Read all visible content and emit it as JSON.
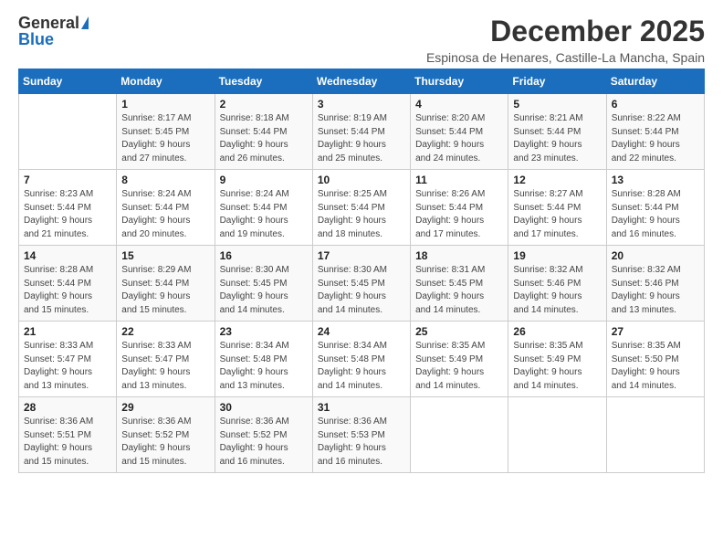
{
  "logo": {
    "general": "General",
    "blue": "Blue"
  },
  "title": "December 2025",
  "subtitle": "Espinosa de Henares, Castille-La Mancha, Spain",
  "headers": [
    "Sunday",
    "Monday",
    "Tuesday",
    "Wednesday",
    "Thursday",
    "Friday",
    "Saturday"
  ],
  "weeks": [
    [
      {
        "day": "",
        "info": ""
      },
      {
        "day": "1",
        "info": "Sunrise: 8:17 AM\nSunset: 5:45 PM\nDaylight: 9 hours\nand 27 minutes."
      },
      {
        "day": "2",
        "info": "Sunrise: 8:18 AM\nSunset: 5:44 PM\nDaylight: 9 hours\nand 26 minutes."
      },
      {
        "day": "3",
        "info": "Sunrise: 8:19 AM\nSunset: 5:44 PM\nDaylight: 9 hours\nand 25 minutes."
      },
      {
        "day": "4",
        "info": "Sunrise: 8:20 AM\nSunset: 5:44 PM\nDaylight: 9 hours\nand 24 minutes."
      },
      {
        "day": "5",
        "info": "Sunrise: 8:21 AM\nSunset: 5:44 PM\nDaylight: 9 hours\nand 23 minutes."
      },
      {
        "day": "6",
        "info": "Sunrise: 8:22 AM\nSunset: 5:44 PM\nDaylight: 9 hours\nand 22 minutes."
      }
    ],
    [
      {
        "day": "7",
        "info": "Sunrise: 8:23 AM\nSunset: 5:44 PM\nDaylight: 9 hours\nand 21 minutes."
      },
      {
        "day": "8",
        "info": "Sunrise: 8:24 AM\nSunset: 5:44 PM\nDaylight: 9 hours\nand 20 minutes."
      },
      {
        "day": "9",
        "info": "Sunrise: 8:24 AM\nSunset: 5:44 PM\nDaylight: 9 hours\nand 19 minutes."
      },
      {
        "day": "10",
        "info": "Sunrise: 8:25 AM\nSunset: 5:44 PM\nDaylight: 9 hours\nand 18 minutes."
      },
      {
        "day": "11",
        "info": "Sunrise: 8:26 AM\nSunset: 5:44 PM\nDaylight: 9 hours\nand 17 minutes."
      },
      {
        "day": "12",
        "info": "Sunrise: 8:27 AM\nSunset: 5:44 PM\nDaylight: 9 hours\nand 17 minutes."
      },
      {
        "day": "13",
        "info": "Sunrise: 8:28 AM\nSunset: 5:44 PM\nDaylight: 9 hours\nand 16 minutes."
      }
    ],
    [
      {
        "day": "14",
        "info": "Sunrise: 8:28 AM\nSunset: 5:44 PM\nDaylight: 9 hours\nand 15 minutes."
      },
      {
        "day": "15",
        "info": "Sunrise: 8:29 AM\nSunset: 5:44 PM\nDaylight: 9 hours\nand 15 minutes."
      },
      {
        "day": "16",
        "info": "Sunrise: 8:30 AM\nSunset: 5:45 PM\nDaylight: 9 hours\nand 14 minutes."
      },
      {
        "day": "17",
        "info": "Sunrise: 8:30 AM\nSunset: 5:45 PM\nDaylight: 9 hours\nand 14 minutes."
      },
      {
        "day": "18",
        "info": "Sunrise: 8:31 AM\nSunset: 5:45 PM\nDaylight: 9 hours\nand 14 minutes."
      },
      {
        "day": "19",
        "info": "Sunrise: 8:32 AM\nSunset: 5:46 PM\nDaylight: 9 hours\nand 14 minutes."
      },
      {
        "day": "20",
        "info": "Sunrise: 8:32 AM\nSunset: 5:46 PM\nDaylight: 9 hours\nand 13 minutes."
      }
    ],
    [
      {
        "day": "21",
        "info": "Sunrise: 8:33 AM\nSunset: 5:47 PM\nDaylight: 9 hours\nand 13 minutes."
      },
      {
        "day": "22",
        "info": "Sunrise: 8:33 AM\nSunset: 5:47 PM\nDaylight: 9 hours\nand 13 minutes."
      },
      {
        "day": "23",
        "info": "Sunrise: 8:34 AM\nSunset: 5:48 PM\nDaylight: 9 hours\nand 13 minutes."
      },
      {
        "day": "24",
        "info": "Sunrise: 8:34 AM\nSunset: 5:48 PM\nDaylight: 9 hours\nand 14 minutes."
      },
      {
        "day": "25",
        "info": "Sunrise: 8:35 AM\nSunset: 5:49 PM\nDaylight: 9 hours\nand 14 minutes."
      },
      {
        "day": "26",
        "info": "Sunrise: 8:35 AM\nSunset: 5:49 PM\nDaylight: 9 hours\nand 14 minutes."
      },
      {
        "day": "27",
        "info": "Sunrise: 8:35 AM\nSunset: 5:50 PM\nDaylight: 9 hours\nand 14 minutes."
      }
    ],
    [
      {
        "day": "28",
        "info": "Sunrise: 8:36 AM\nSunset: 5:51 PM\nDaylight: 9 hours\nand 15 minutes."
      },
      {
        "day": "29",
        "info": "Sunrise: 8:36 AM\nSunset: 5:52 PM\nDaylight: 9 hours\nand 15 minutes."
      },
      {
        "day": "30",
        "info": "Sunrise: 8:36 AM\nSunset: 5:52 PM\nDaylight: 9 hours\nand 16 minutes."
      },
      {
        "day": "31",
        "info": "Sunrise: 8:36 AM\nSunset: 5:53 PM\nDaylight: 9 hours\nand 16 minutes."
      },
      {
        "day": "",
        "info": ""
      },
      {
        "day": "",
        "info": ""
      },
      {
        "day": "",
        "info": ""
      }
    ]
  ]
}
